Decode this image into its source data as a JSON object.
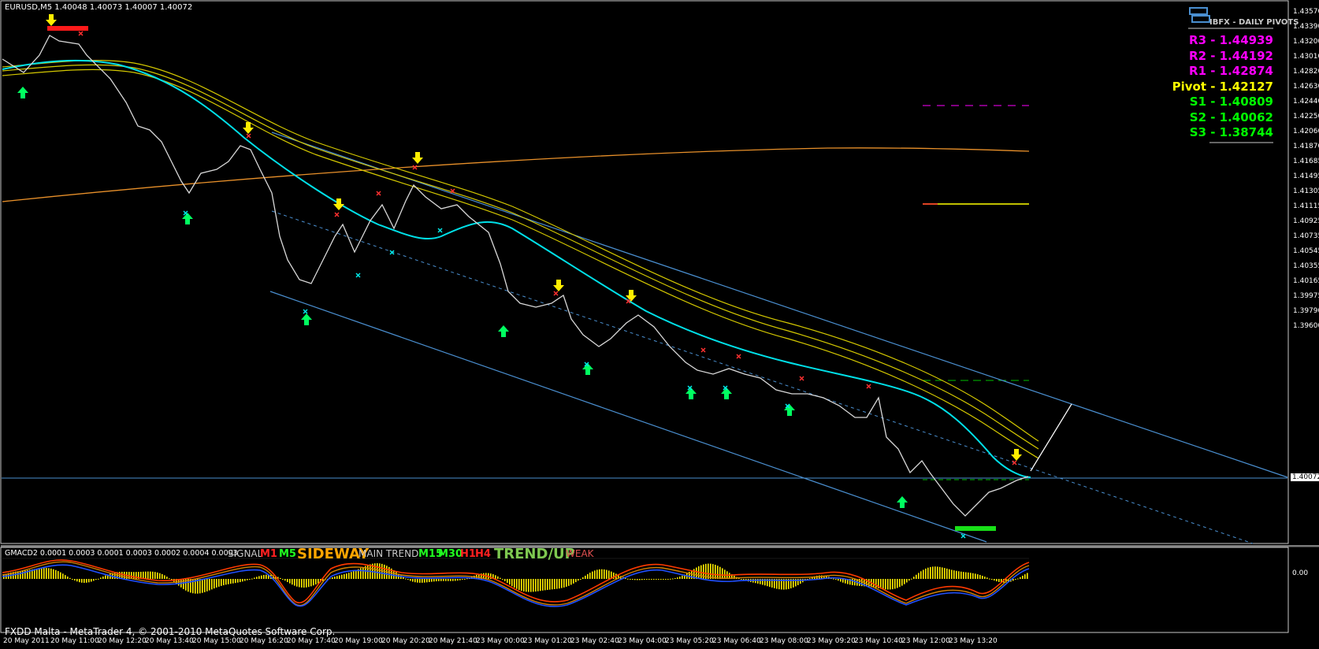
{
  "symbol_header": "EURUSD,M5  1.40048 1.40073 1.40007 1.40072",
  "pivots": {
    "title": "IBFX - DAILY PIVOTS",
    "levels": [
      {
        "label": "R3 - 1.44939",
        "color": "#ff00ff"
      },
      {
        "label": "R2 - 1.44192",
        "color": "#ff00ff"
      },
      {
        "label": "R1 - 1.42874",
        "color": "#ff00ff"
      },
      {
        "label": "Pivot - 1.42127",
        "color": "#ffff00"
      },
      {
        "label": "S1 - 1.40809",
        "color": "#00ff00"
      },
      {
        "label": "S2 - 1.40062",
        "color": "#00ff00"
      },
      {
        "label": "S3 - 1.38744",
        "color": "#00ff00"
      }
    ]
  },
  "price_axis": [
    "1.43570",
    "1.43390",
    "1.43200",
    "1.43010",
    "1.42820",
    "1.42630",
    "1.42440",
    "1.42250",
    "1.42060",
    "1.41870",
    "1.41685",
    "1.41495",
    "1.41305",
    "1.41115",
    "1.40925",
    "1.40735",
    "1.40545",
    "1.40355",
    "1.40165",
    "1.39975",
    "1.39790",
    "1.39600"
  ],
  "current_price": "1.40072",
  "indicator": {
    "header": "GMACD2 0.0001 0.0003 0.0001 0.0003 0.0002 0.0004 0.0003",
    "zero_label": "0.00",
    "signal_label": "SIGNAL",
    "m1": "M1",
    "m5": "M5",
    "sideway": "SIDEWAY",
    "main_trend": "MAIN TREND",
    "m15": "M15",
    "m30": "M30",
    "h1": "H1",
    "h4": "H4",
    "trend_up": "TREND/UP",
    "weak": "WEAK"
  },
  "time_axis": [
    "20 May 2011",
    "20 May 11:00",
    "20 May 12:20",
    "20 May 13:40",
    "20 May 15:00",
    "20 May 16:20",
    "20 May 17:40",
    "20 May 19:00",
    "20 May 20:20",
    "20 May 21:40",
    "23 May 00:00",
    "23 May 01:20",
    "23 May 02:40",
    "23 May 04:00",
    "23 May 05:20",
    "23 May 06:40",
    "23 May 08:00",
    "23 May 09:20",
    "23 May 10:40",
    "23 May 12:00",
    "23 May 13:20"
  ],
  "status_bar": "FXDD Malta - MetaTrader 4, © 2001-2010 MetaQuotes Software Corp."
}
